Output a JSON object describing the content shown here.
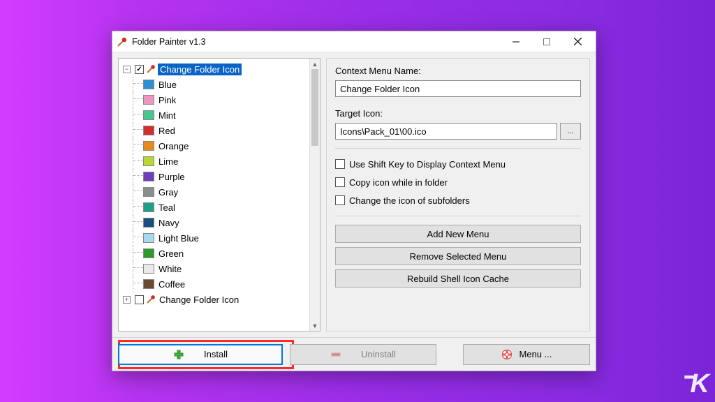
{
  "window": {
    "title": "Folder Painter v1.3"
  },
  "tree": {
    "root1": {
      "label": "Change Folder Icon",
      "checked": true,
      "expanded": true,
      "selected": true
    },
    "items": [
      {
        "label": "Blue",
        "color": "#2f8fd3"
      },
      {
        "label": "Pink",
        "color": "#f095c0"
      },
      {
        "label": "Mint",
        "color": "#46c78f"
      },
      {
        "label": "Red",
        "color": "#d22f2f"
      },
      {
        "label": "Orange",
        "color": "#e88a1a"
      },
      {
        "label": "Lime",
        "color": "#b8d634"
      },
      {
        "label": "Purple",
        "color": "#6f3fb8"
      },
      {
        "label": "Gray",
        "color": "#8c8c8c"
      },
      {
        "label": "Teal",
        "color": "#1f9e8a"
      },
      {
        "label": "Navy",
        "color": "#1b4d80"
      },
      {
        "label": "Light Blue",
        "color": "#a6d8ef"
      },
      {
        "label": "Green",
        "color": "#2e9a2e"
      },
      {
        "label": "White",
        "color": "#e9e9e9"
      },
      {
        "label": "Coffee",
        "color": "#6a4a30"
      }
    ],
    "root2": {
      "label": "Change Folder Icon",
      "checked": false,
      "expanded": false
    }
  },
  "right": {
    "contextMenuNameLabel": "Context Menu Name:",
    "contextMenuNameValue": "Change Folder Icon",
    "targetIconLabel": "Target Icon:",
    "targetIconValue": "Icons\\Pack_01\\00.ico",
    "browse": "...",
    "opts": {
      "shiftKey": "Use Shift Key to Display Context Menu",
      "copyIcon": "Copy icon while in folder",
      "subfolders": "Change the icon of subfolders"
    },
    "buttons": {
      "addNewMenu": "Add New Menu",
      "removeSelected": "Remove Selected Menu",
      "rebuildCache": "Rebuild Shell Icon Cache"
    }
  },
  "bottom": {
    "install": "Install",
    "uninstall": "Uninstall",
    "menu": "Menu ..."
  }
}
